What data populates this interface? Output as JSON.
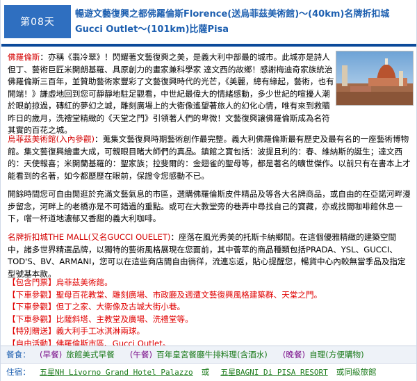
{
  "header": {
    "day": "第08天",
    "title_line1": "暢遊文藝復興之都佛羅倫斯Florence(送烏菲茲美術館)～(40km)名牌折扣城",
    "title_line2": "Gucci Outlet～(101km)比薩Pisa"
  },
  "photo": {
    "icon": "florence-cathedral-photo"
  },
  "florence": {
    "lead": "佛羅倫斯",
    "text": "：亦稱《翡冷翠》！閃耀著文藝復興之美，是義大利中部最的城市。此城亦是詩人但丁、藝術巨匠米開朗基羅、具原創力的畫家兼科學家 達文西的故鄉！感謝梅迪奇家族統治佛羅倫斯三百年，並贊助藝術家豐彩了文藝復興時代的光芒，《美麗，總有緣起，藝術，也有開端！》謙虛地回到您可靜靜地駐足觀看，中世紀最偉大的情緒感動，多少世紀的喧擾人潮於眼前掠過，磚紅的夢幻之城，雕刻廣場上的大衛像遙望著旅人的幻化心情，唯有來到救贖昨日的歲月，洗禮堂精緻的《天堂之門》引領著人們的卑微！文藝復興讓佛羅倫斯成為名符其實的百花之城。"
  },
  "uffizi": {
    "lead": "烏菲茲美術館",
    "lead_note": "(入內參觀)",
    "text": "：蒐集文藝復興時期藝術創作最完整。義大利佛羅倫斯最有歷史及最有名的一座藝術博物館。集文藝復興繪畫大成，可親眼目睹大師們的真品。鎮館之寶包括：波提且利的：春、維納斯的誕生；達文西的：天使報喜；米開蘭基羅的：聖家族；拉斐爾的：金翅雀的聖母等，都是著名的曠世傑作。以前只有在書本上才能看到的名著，如今都歷歷在眼前，保證令您感動不已。"
  },
  "freetime": {
    "text": "開餘時間您可自由閒逛於充滿文藝氣息的市區，選購佛羅倫斯皮件精品及等各大名牌商品，或自由的在亞諾河畔漫步留念，河畔上的老橋亦是不可錯過的重點。或可在大教堂旁的巷弄中尋找自己的寶藏，亦或找間咖啡館休息一下，嚐一杯道地濃郁又香甜的義大利咖啡。"
  },
  "outlet": {
    "lead": "名牌折扣城THE MALL(又名GUCCI OUELET)",
    "text": "：座落在風光秀美的托斯卡納鄉間。在這個優雅精緻的建築空間中，諸多世界精選品牌，以獨特的藝術風格展現在您面前，其中薈萃的商品種類包括PRADA、YSL、GUCCI、TOD'S、BV、ARMANI，您可以在這些商店間自由徜徉，流連忘返，貼心提醒您，暢貨中心內較無當季品及指定型號基本款。"
  },
  "lists": [
    "【包含門票】烏菲茲美術館。",
    "【下車參觀】聖母百花教堂、雕刻廣場、市政廳及週遭文藝復興風格建築群、天堂之門。",
    "【下車參觀】但丁之家、大衛像及古城大街小巷。",
    "【下車參觀】比薩斜塔、主教堂及廣場、洗禮堂等。",
    "【特別贈送】義大利手工冰淇淋兩球。",
    "【自由活動】佛羅倫斯市區、Gucci Outlet。"
  ],
  "info": {
    "meal_label": "餐食：",
    "breakfast_k": "(早餐)",
    "breakfast_v": "旅館美式早餐",
    "lunch_k": "(午餐)",
    "lunch_v": "百年皇宮餐廳牛排料理(含酒水)",
    "dinner_k": "(晚餐)",
    "dinner_v": "自理(方便購物)",
    "hotel_label": "住宿：",
    "hotel1": "五星NH Livorno Grand Hotel Palazzo",
    "or": "或",
    "hotel2": "五星BAGNI Di PISA RESORT",
    "hotel_suffix": "或同級旅館"
  }
}
